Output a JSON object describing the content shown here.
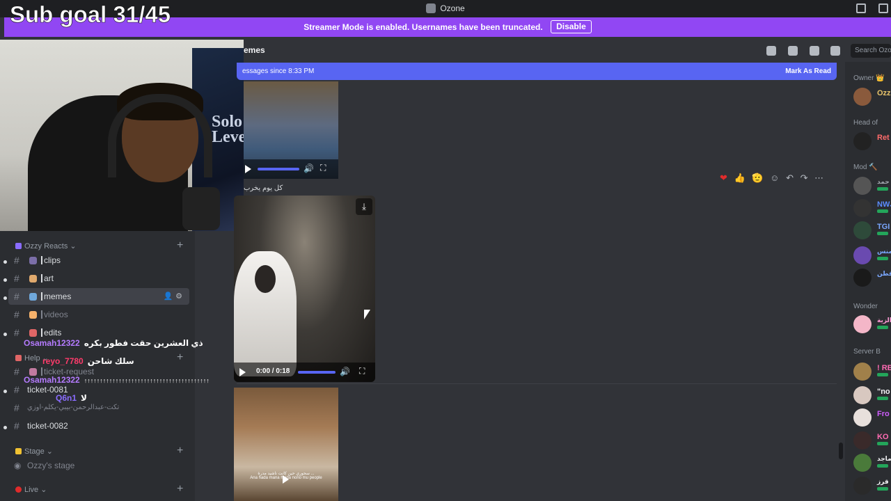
{
  "window": {
    "title": "Ozone"
  },
  "stream": {
    "sub_goal": "Sub goal 31/45"
  },
  "banner": {
    "text": "Streamer Mode is enabled. Usernames have been truncated.",
    "button": "Disable"
  },
  "channel": {
    "name": "emes"
  },
  "new_messages": {
    "text": "essages since 8:33 PM",
    "action": "Mark As Read"
  },
  "search": {
    "placeholder": "Search Ozo"
  },
  "sidebar": {
    "categories": [
      {
        "label": "Ozzy Reacts"
      },
      {
        "label": "Help"
      },
      {
        "label": "Stage"
      },
      {
        "label": "Live"
      }
    ],
    "channels": [
      {
        "label": "clips"
      },
      {
        "label": "art"
      },
      {
        "label": "memes"
      },
      {
        "label": "videos"
      },
      {
        "label": "edits"
      },
      {
        "label": "ticket-request"
      },
      {
        "label": "ticket-0081"
      },
      {
        "label": "تكت-عبدالرحمن-بيبي-يكلم-اوزي"
      },
      {
        "label": "ticket-0082"
      },
      {
        "label": "Ozzy's stage"
      }
    ]
  },
  "stream_chat": [
    {
      "user": "Osamah12322",
      "text": "ذي العشرين حقت فطور بكره",
      "color": "#b57bff"
    },
    {
      "user": "reyo_7780",
      "text": "سلك شاحن",
      "color": "#ff3b6b"
    },
    {
      "user": "Osamah12322",
      "text": "↑↑↑↑↑↑↑↑↑↑↑↑↑↑↑↑↑↑↑↑↑↑↑↑↑↑↑↑↑↑↑↑↑↑↑↑↑↑↑↑",
      "color": "#b57bff"
    },
    {
      "user": "Q6n1",
      "text": "لا",
      "color": "#8a6cff"
    }
  ],
  "messages": {
    "caption": "كل يوم يخرب",
    "video_time": "0:00 / 0:18",
    "video3_caption_ar": "سحوري حين كانت ناشيد مدرة ...",
    "video3_caption_en": "Ana hada mana heida nono mu people"
  },
  "reactions": [
    "❤",
    "👍",
    "🫡"
  ],
  "members": {
    "groups": [
      {
        "label": "Owner 👑"
      },
      {
        "label": "Head of"
      },
      {
        "label": "Mod 🔨"
      },
      {
        "label": "Wonder"
      },
      {
        "label": "Server B"
      }
    ],
    "items": [
      {
        "name": "Ozz",
        "color": "#e7c36a"
      },
      {
        "name": "Ret",
        "color": "#ff6b6b"
      },
      {
        "name": "حمد !",
        "color": "#a0a6ad"
      },
      {
        "name": "NWJ",
        "color": "#5b8cff"
      },
      {
        "name": "TGI",
        "color": "#7aa7ff"
      },
      {
        "name": "المنس",
        "color": "#7aa7ff"
      },
      {
        "name": "قطن",
        "color": "#7aa7ff"
      },
      {
        "name": "والزية",
        "color": "#ff9ad5"
      },
      {
        "name": "! RE",
        "color": "#ff6bb3"
      },
      {
        "name": "\"no",
        "color": "#f2f3f5"
      },
      {
        "name": "Fro",
        "color": "#d05cff"
      },
      {
        "name": "KO",
        "color": "#ff6bb3"
      },
      {
        "name": "ماجد",
        "color": "#f2f3f5"
      },
      {
        "name": "قرز",
        "color": "#f2f3f5"
      }
    ]
  },
  "colors": {
    "blurple": "#5865f2",
    "twitch_purple": "#9147f3",
    "bg": "#313338",
    "sidebar": "#2b2d31"
  }
}
